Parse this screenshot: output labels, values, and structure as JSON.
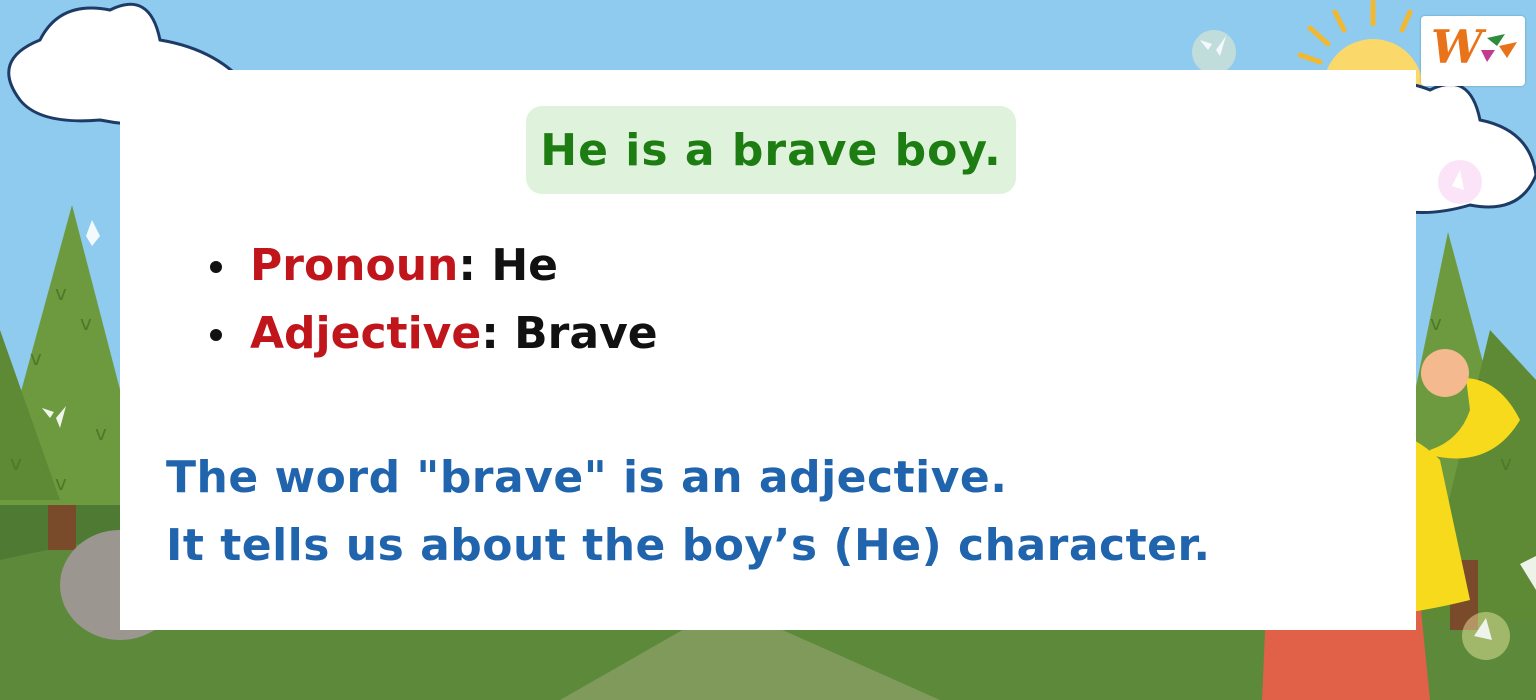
{
  "sentence": "He is a brave boy.",
  "parts": [
    {
      "term": "Pronoun",
      "sep": ":",
      "value": "He"
    },
    {
      "term": "Adjective",
      "sep": ":",
      "value": "Brave"
    }
  ],
  "explanation": [
    "The word \"brave\" is an adjective.",
    "It tells us about the boy’s (He) character."
  ],
  "logo": {
    "letter": "W"
  },
  "colors": {
    "sky": "#8ecbee",
    "grass": "#5c8a3a",
    "sentence_text": "#1e7d12",
    "sentence_bg": "#dff2dc",
    "term": "#c0161b",
    "explanation": "#1f64ad",
    "sun": "#fad86a",
    "shirt": "#f7da1c",
    "pants": "#e06048"
  }
}
